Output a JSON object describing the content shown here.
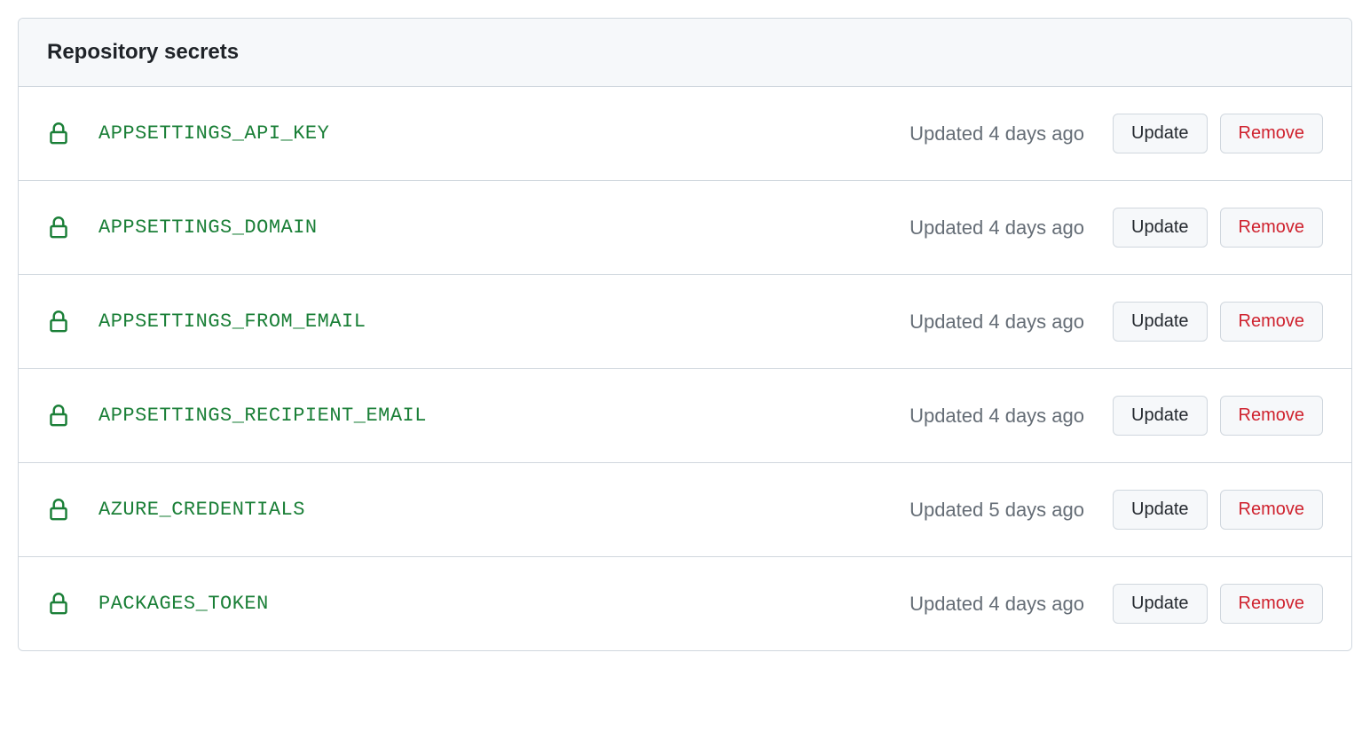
{
  "panel": {
    "title": "Repository secrets"
  },
  "buttons": {
    "update": "Update",
    "remove": "Remove"
  },
  "secrets": [
    {
      "name": "APPSETTINGS_API_KEY",
      "updated": "Updated 4 days ago"
    },
    {
      "name": "APPSETTINGS_DOMAIN",
      "updated": "Updated 4 days ago"
    },
    {
      "name": "APPSETTINGS_FROM_EMAIL",
      "updated": "Updated 4 days ago"
    },
    {
      "name": "APPSETTINGS_RECIPIENT_EMAIL",
      "updated": "Updated 4 days ago"
    },
    {
      "name": "AZURE_CREDENTIALS",
      "updated": "Updated 5 days ago"
    },
    {
      "name": "PACKAGES_TOKEN",
      "updated": "Updated 4 days ago"
    }
  ]
}
